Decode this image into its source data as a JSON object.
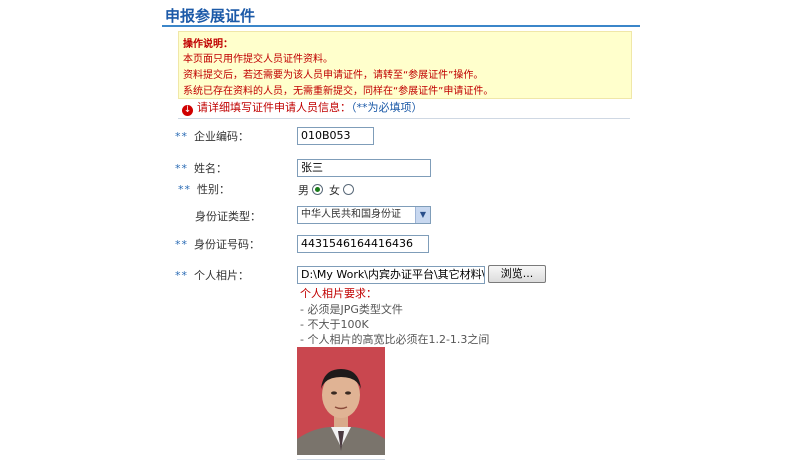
{
  "page": {
    "title": "申报参展证件"
  },
  "notice": {
    "heading": "操作说明：",
    "lines": [
      "本页面只用作提交人员证件资料。",
      "资料提交后，若还需要为该人员申请证件，请转至“参展证件”操作。",
      "系统已存在资料的人员，无需重新提交，同样在“参展证件”申请证件。"
    ]
  },
  "hint": {
    "text": "请详细填写证件申请人员信息：",
    "required_note": "（**为必填项）"
  },
  "form": {
    "required_marker": "**",
    "company_code": {
      "label": "企业编码：",
      "value": "010B053"
    },
    "name": {
      "label": "姓名：",
      "value": "张三"
    },
    "gender": {
      "label": "性别：",
      "male": "男",
      "female": "女",
      "selected": "男"
    },
    "id_type": {
      "label": "身份证类型：",
      "selected": "中华人民共和国身份证"
    },
    "id_number": {
      "label": "身份证号码：",
      "value": "4431546164416436"
    },
    "photo": {
      "label": "个人相片：",
      "file_path": "D:\\My Work\\内宾办证平台\\其它材料\\",
      "browse_label": "浏览...",
      "requirements_title": "个人相片要求：",
      "requirements": [
        "- 必须是JPG类型文件",
        "- 不大于100K",
        "- 个人相片的高宽比必须在1.2-1.3之间"
      ]
    }
  },
  "colors": {
    "title": "#1c5aa8",
    "notice_bg": "#ffffcc",
    "notice_text": "#c00000",
    "required_marker": "#2b6cb5"
  }
}
